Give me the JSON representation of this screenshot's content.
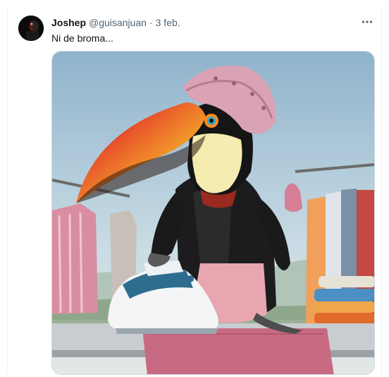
{
  "tweet": {
    "author_name": "Joshep",
    "author_handle": "@guisanjuan",
    "separator": "·",
    "date": "3 feb.",
    "text": "Ni de broma..."
  },
  "icons": {
    "more": "more-horizontal-icon"
  },
  "colors": {
    "secondary_text": "#536471",
    "primary_text": "#0f1419",
    "border": "#cfd9de"
  }
}
